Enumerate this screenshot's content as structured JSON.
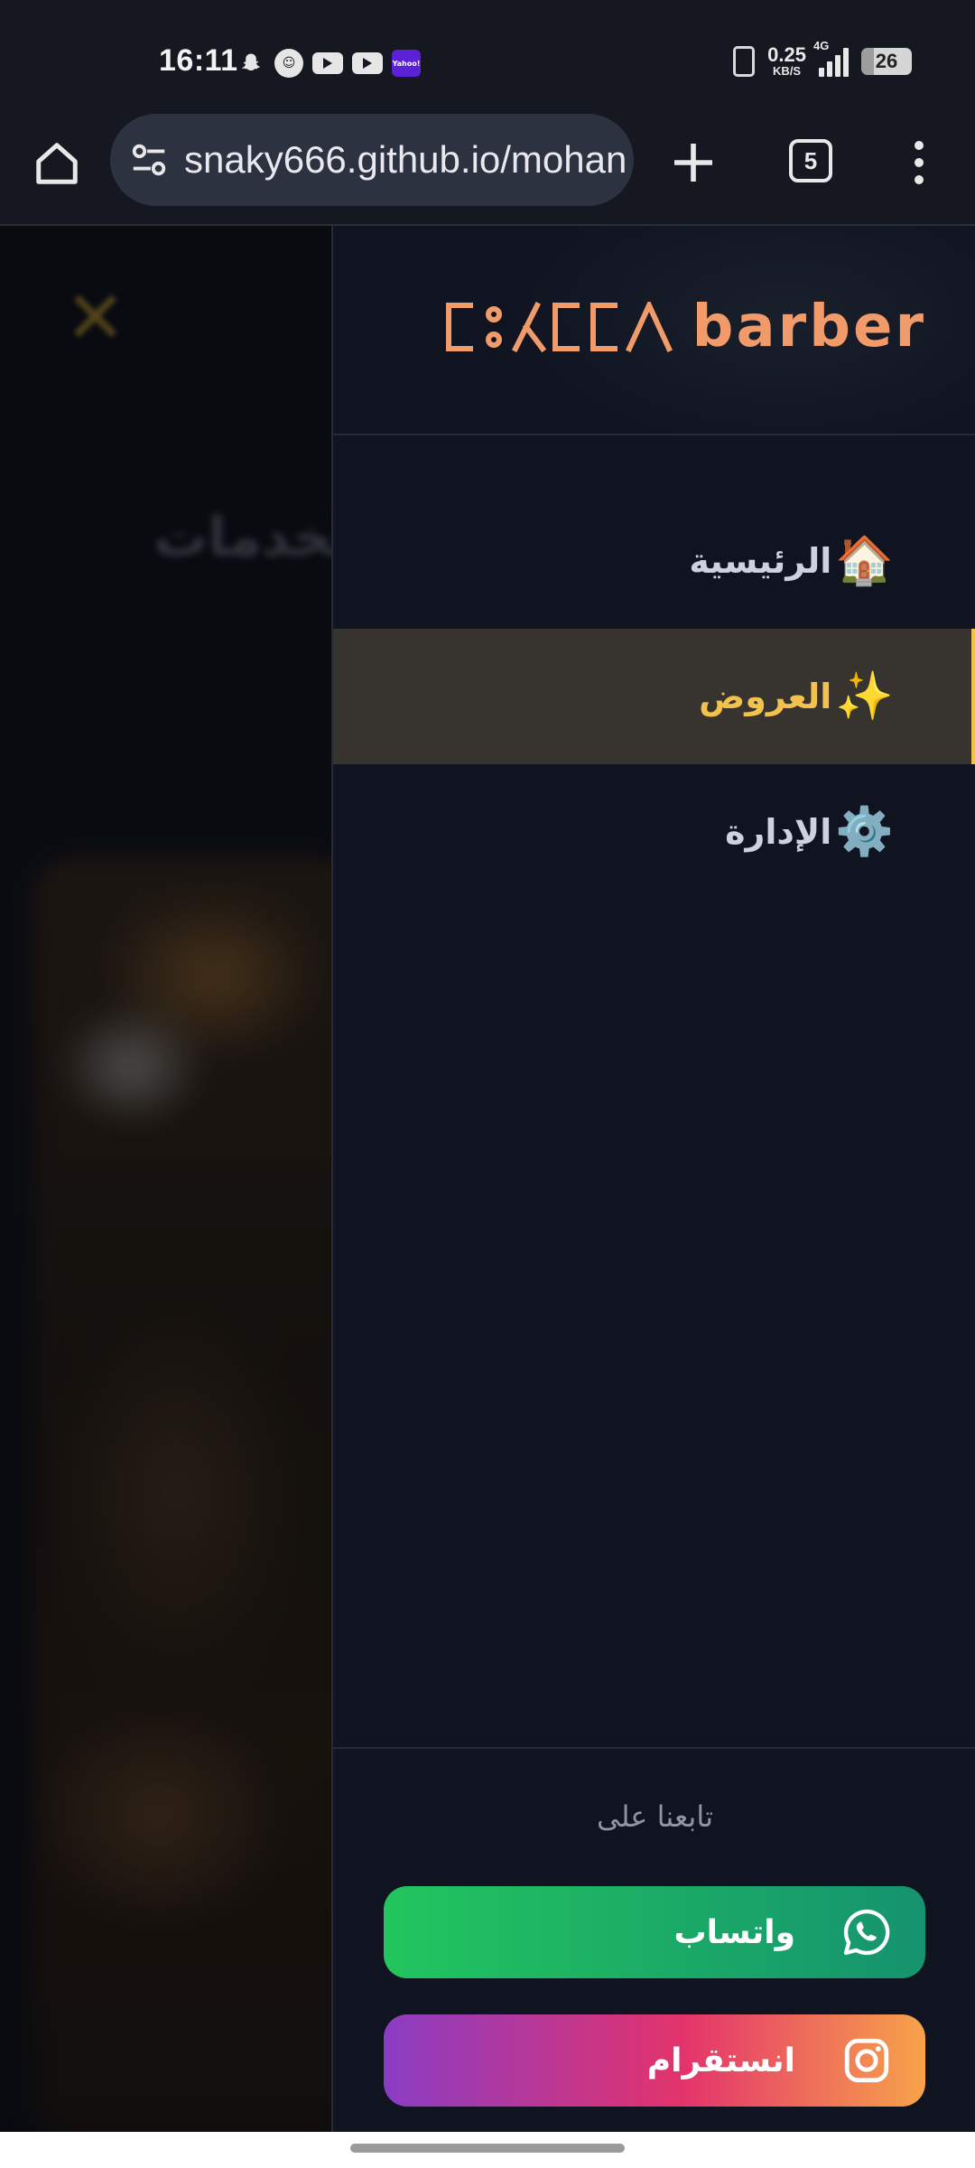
{
  "status_bar": {
    "time": "16:11",
    "net_speed_value": "0.25",
    "net_speed_unit": "KB/S",
    "network_type": "4G",
    "battery": "26",
    "notification_icons": [
      "snapchat-icon",
      "app-icon",
      "youtube-icon",
      "youtube-icon",
      "yahoo-icon"
    ],
    "yahoo_label": "Yahoo!"
  },
  "browser": {
    "url": "snaky666.github.io/mohan",
    "tab_count": "5",
    "icons": [
      "home-icon",
      "site-settings-icon",
      "new-tab-icon",
      "tab-switcher-icon",
      "more-menu-icon"
    ]
  },
  "backdrop": {
    "close_glyph": "✕",
    "title_fragment": "الخدمات"
  },
  "drawer": {
    "brand_word": "barber",
    "brand_tifinagh_glyphs": "ⵎⵓⵃⵏⵏⴷ",
    "nav": [
      {
        "emoji": "🏠",
        "label": "الرئيسية",
        "active": false
      },
      {
        "emoji": "✨",
        "label": "العروض",
        "active": true
      },
      {
        "emoji": "⚙️",
        "label": "الإدارة",
        "active": false
      }
    ],
    "follow_us": "تابعنا على",
    "whatsapp_label": "واتساب",
    "instagram_label": "انستقرام"
  },
  "colors": {
    "accent_gold": "#f2c14e",
    "brand_orange": "#f19a6a",
    "drawer_bg": "#0f1420",
    "active_item_bg": "#37332f",
    "whatsapp_start": "#22c55e",
    "whatsapp_end": "#15936e",
    "instagram_start": "#8b3cc4",
    "instagram_mid": "#e3336c",
    "instagram_end": "#f7a34a"
  }
}
